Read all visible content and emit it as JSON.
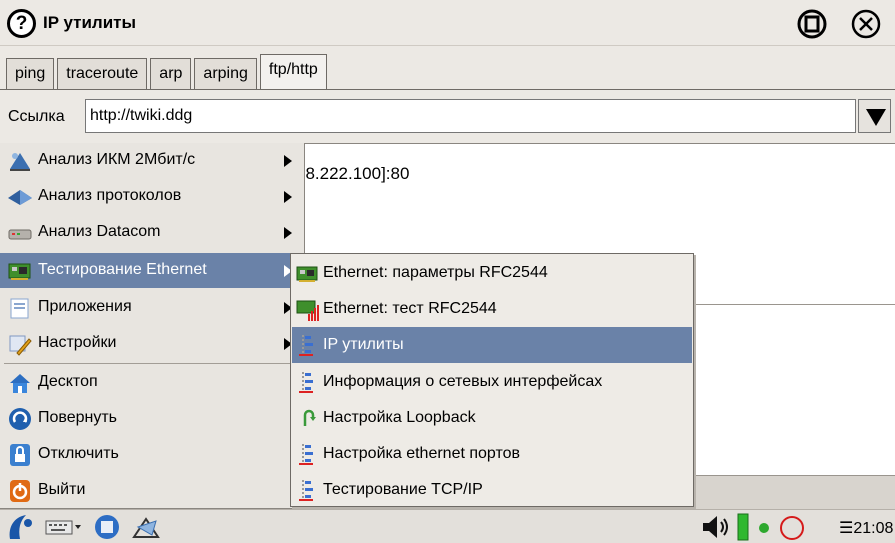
{
  "window": {
    "help_glyph": "?",
    "title": "IP утилиты"
  },
  "tabs": [
    {
      "label": "ping"
    },
    {
      "label": "traceroute"
    },
    {
      "label": "arp"
    },
    {
      "label": "arping"
    },
    {
      "label": "ftp/http",
      "active": true
    }
  ],
  "link": {
    "label": "Ссылка",
    "value": "http://twiki.ddg"
  },
  "content": {
    "text": "58.222.100]:80"
  },
  "menu": {
    "items": [
      {
        "label": "Анализ ИКМ 2Мбит/с",
        "icon": "satellite-dish-icon",
        "submenu": true
      },
      {
        "label": "Анализ протоколов",
        "icon": "network-protocol-icon",
        "submenu": true
      },
      {
        "label": "Анализ Datacom",
        "icon": "modem-icon",
        "submenu": true
      },
      {
        "label": "Тестирование Ethernet",
        "icon": "network-card-icon",
        "submenu": true,
        "highlighted": true
      },
      {
        "label": "Приложения",
        "icon": "applications-icon",
        "submenu": true
      },
      {
        "label": "Настройки",
        "icon": "settings-icon",
        "submenu": true
      },
      {
        "label": "Десктоп",
        "icon": "desktop-icon"
      },
      {
        "label": "Повернуть",
        "icon": "rotate-icon"
      },
      {
        "label": "Отключить",
        "icon": "lock-icon"
      },
      {
        "label": "Выйти",
        "icon": "power-icon"
      }
    ]
  },
  "submenu": {
    "items": [
      {
        "label": "Ethernet: параметры RFC2544",
        "icon": "network-card-icon"
      },
      {
        "label": "Ethernet: тест RFC2544",
        "icon": "network-test-icon"
      },
      {
        "label": "IP утилиты",
        "icon": "network-tool-icon",
        "highlighted": true
      },
      {
        "label": "Информация о сетевых интерфейсах",
        "icon": "network-tool-icon"
      },
      {
        "label": "Настройка Loopback",
        "icon": "loopback-icon"
      },
      {
        "label": "Настройка ethernet портов",
        "icon": "network-tool-icon"
      },
      {
        "label": "Тестирование TCP/IP",
        "icon": "network-tool-icon"
      }
    ]
  },
  "taskbar": {
    "clock_prefix": "☰",
    "clock": "21:08"
  },
  "colors": {
    "highlight": "#6a82a8",
    "background": "#ece9e4"
  }
}
